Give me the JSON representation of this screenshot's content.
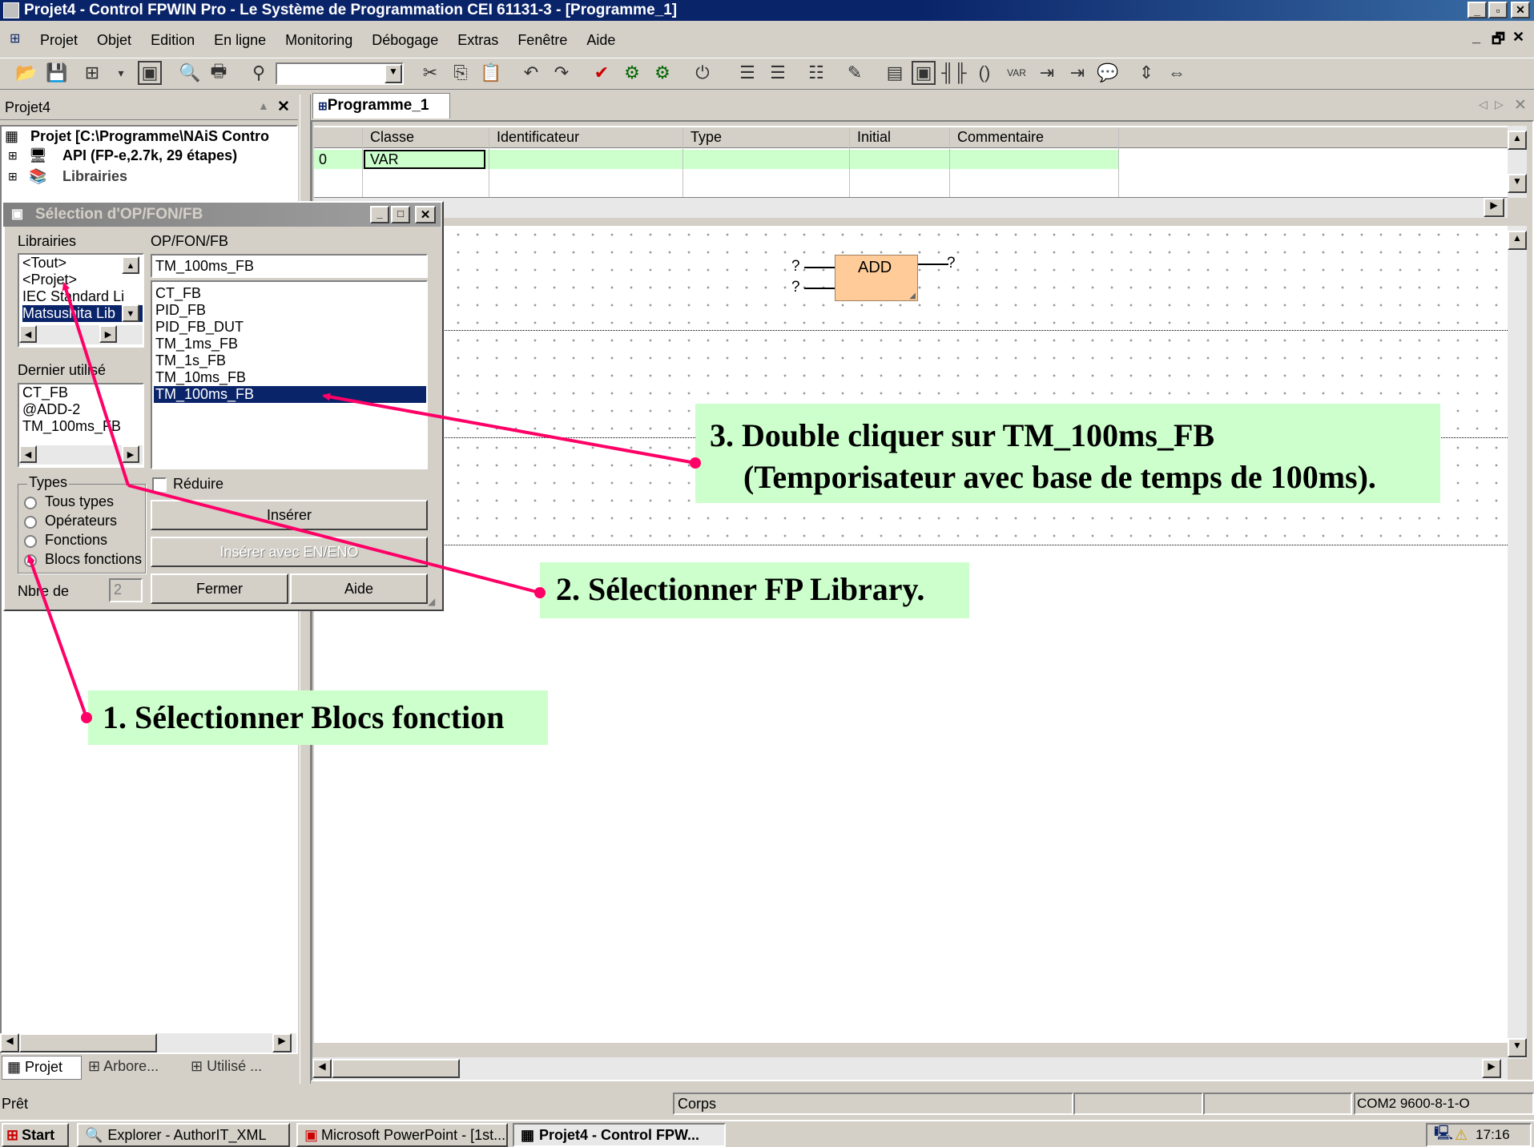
{
  "window": {
    "title": "Projet4 - Control FPWIN Pro - Le Système de Programmation CEI 61131-3 - [Programme_1]"
  },
  "menu": [
    "Projet",
    "Objet",
    "Edition",
    "En ligne",
    "Monitoring",
    "Débogage",
    "Extras",
    "Fenêtre",
    "Aide"
  ],
  "project_panel": {
    "title": "Projet4",
    "tree": [
      "Projet [C:\\Programme\\NAiS Contro",
      "API (FP-e,2.7k, 29 étapes)",
      "Librairies"
    ],
    "tabs": [
      "Projet",
      "Arbore...",
      "Utilisé ..."
    ]
  },
  "editor": {
    "tab": "Programme_1",
    "columns": [
      "Classe",
      "Identificateur",
      "Type",
      "Initial",
      "Commentaire"
    ],
    "row": {
      "num": "0",
      "classe": "VAR"
    },
    "block": {
      "label": "ADD",
      "in1": "?",
      "in2": "?",
      "out": "?"
    }
  },
  "dialog": {
    "title": "Sélection d'OP/FON/FB",
    "libraries_label": "Librairies",
    "libraries": [
      "<Tout>",
      "<Projet>",
      "IEC Standard Li",
      "Matsushita Lib"
    ],
    "selected_library": "Matsushita Lib",
    "opfon_label": "OP/FON/FB",
    "opfon_input": "TM_100ms_FB",
    "opfon_list": [
      "CT_FB",
      "PID_FB",
      "PID_FB_DUT",
      "TM_1ms_FB",
      "TM_1s_FB",
      "TM_10ms_FB",
      "TM_100ms_FB"
    ],
    "selected_opfon": "TM_100ms_FB",
    "last_used_label": "Dernier utilisé",
    "last_used": [
      "CT_FB",
      "@ADD-2",
      "TM_100ms_FB"
    ],
    "types_label": "Types",
    "types": [
      "Tous types",
      "Opérateurs",
      "Fonctions",
      "Blocs fonctions"
    ],
    "selected_type": "Blocs fonctions",
    "reduce_label": "Réduire",
    "insert_label": "Insérer",
    "insert_en_label": "Insérer avec EN/ENO",
    "close_label": "Fermer",
    "help_label": "Aide",
    "count_label": "Nbre de",
    "count_value": "2"
  },
  "callouts": {
    "step1": "1. Sélectionner Blocs fonction",
    "step2": "2. Sélectionner FP Library.",
    "step3_line1": "3. Double cliquer sur TM_100ms_FB",
    "step3_line2": "(Temporisateur avec base de temps de 100ms)."
  },
  "statusbar": {
    "left": "Prêt",
    "middle": "Corps",
    "right": "COM2 9600-8-1-O"
  },
  "taskbar": {
    "start": "Start",
    "items": [
      "Explorer - AuthorIT_XML",
      "Microsoft PowerPoint - [1st...",
      "Projet4 - Control FPW..."
    ],
    "clock": "17:16"
  },
  "colors": {
    "callout_bg": "#ccffcc",
    "arrow": "#ff0066",
    "titlebar": "#0a246a",
    "selection": "#0a246a",
    "var_row": "#ccffcc",
    "block": "#ffcc99"
  }
}
